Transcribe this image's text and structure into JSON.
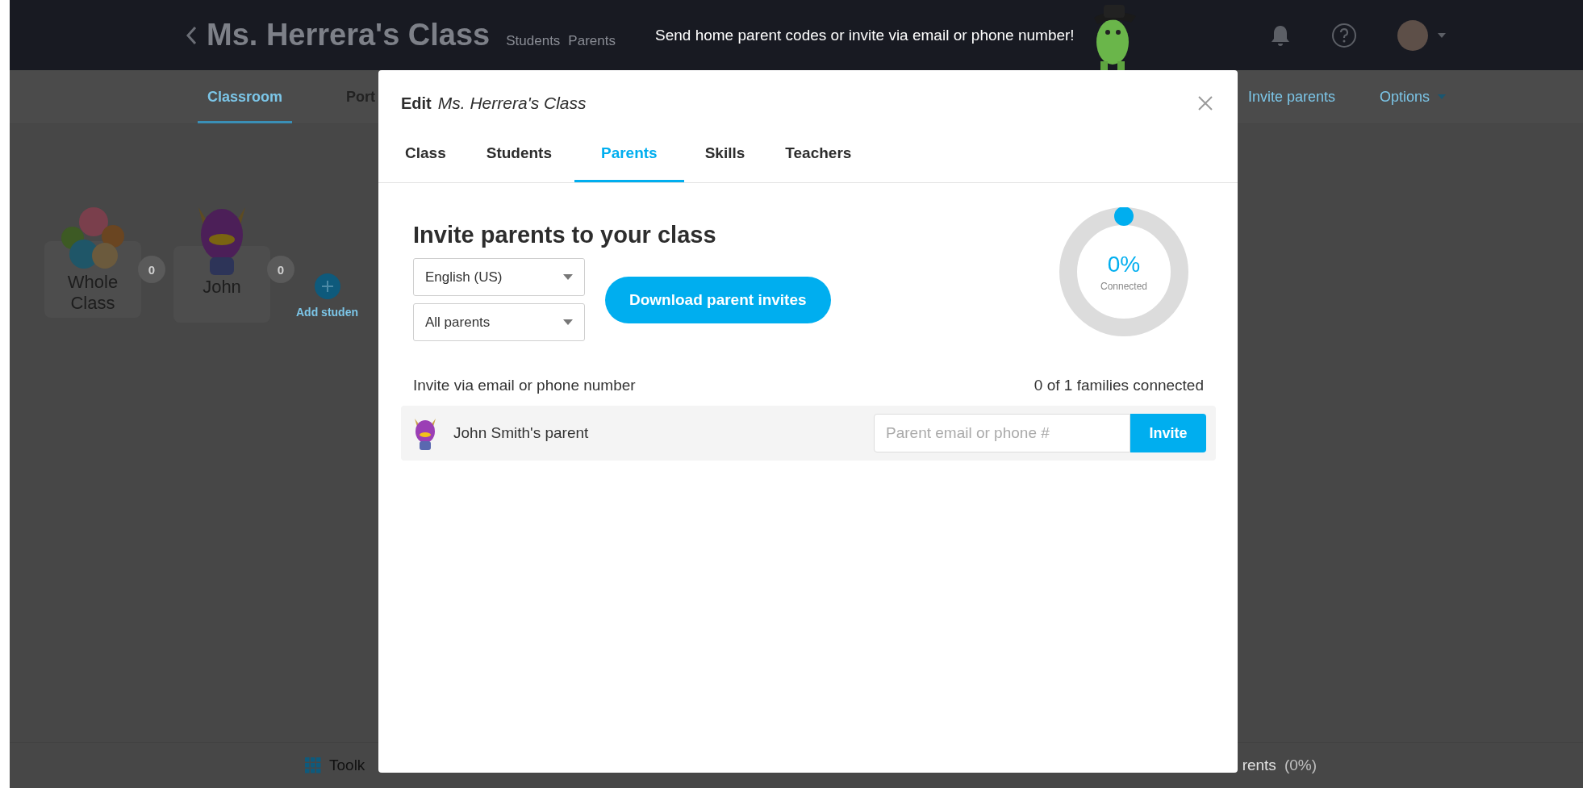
{
  "app_bar": {
    "title": "Ms. Herrera's Class",
    "breadcrumbs": [
      {
        "label": "Students"
      },
      {
        "label": "Parents"
      }
    ]
  },
  "tooltip": {
    "text": "Send home parent codes or invite via email or phone number!"
  },
  "nav": {
    "tabs": [
      {
        "label": "Classroom",
        "selected": true
      },
      {
        "label": "Port",
        "selected": false
      }
    ],
    "actions": [
      {
        "label": "Invite parents",
        "kind": "link"
      },
      {
        "label": "Options",
        "kind": "menu"
      }
    ]
  },
  "students": [
    {
      "name": "Whole Class",
      "points": "0",
      "kind": "group"
    },
    {
      "name": "John",
      "points": "0",
      "kind": "student"
    }
  ],
  "add_student": {
    "label": "Add studen"
  },
  "bottom_bar": {
    "toolkit": "Toolk",
    "parents": "rents",
    "parents_percent": "(0%)"
  },
  "modal": {
    "title_prefix": "Edit",
    "class_name": "Ms. Herrera's Class",
    "tabs": [
      {
        "label": "Class",
        "selected": false
      },
      {
        "label": "Students",
        "selected": false
      },
      {
        "label": "Parents",
        "selected": true
      },
      {
        "label": "Skills",
        "selected": false
      },
      {
        "label": "Teachers",
        "selected": false
      }
    ],
    "heading": "Invite parents to your class",
    "language": {
      "value": "English (US)"
    },
    "audience": {
      "value": "All parents"
    },
    "download_button": "Download parent invites",
    "progress": {
      "level": 0,
      "percent": "0%",
      "caption": "Connected"
    },
    "invite_label": "Invite via email or phone number",
    "families_status": "0 of 1 families connected",
    "parents": [
      {
        "name": "John Smith's parent",
        "placeholder": "Parent email or phone #",
        "button": "Invite"
      }
    ]
  }
}
